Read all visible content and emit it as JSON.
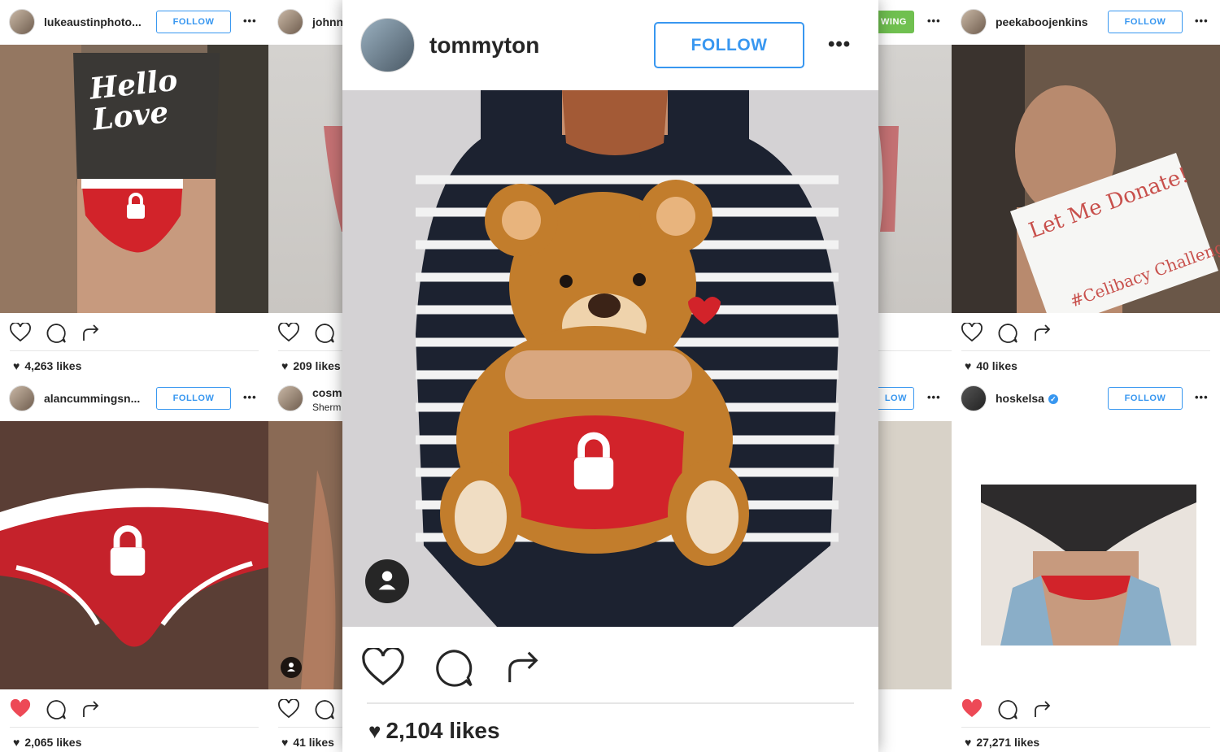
{
  "colors": {
    "accent": "#3897f0",
    "following": "#70c050",
    "like_red": "#ed4956",
    "brief_red": "#d2232a"
  },
  "posts": [
    {
      "id": "p1",
      "username": "lukeaustinphoto...",
      "follow_label": "FOLLOW",
      "more": "•••",
      "likes": "4,263 likes",
      "liked": false,
      "photo_text": "Hello Love"
    },
    {
      "id": "p2",
      "username": "johnn",
      "likes": "209 likes",
      "liked": false
    },
    {
      "id": "p3",
      "follow_label": "WING",
      "more": "•••"
    },
    {
      "id": "p4",
      "username": "peekaboojenkins",
      "follow_label": "FOLLOW",
      "more": "•••",
      "likes": "40 likes",
      "liked": false,
      "photo_text_1": "Let Me Donate!",
      "photo_text_2": "#Celibacy Challenge"
    },
    {
      "id": "p5",
      "username": "alancummingsn...",
      "follow_label": "FOLLOW",
      "more": "•••",
      "likes": "2,065 likes",
      "liked": true
    },
    {
      "id": "p6",
      "username": "cosm",
      "subline": "Sherm",
      "likes": "41 likes",
      "liked": false
    },
    {
      "id": "p7",
      "follow_label": "LOW",
      "more": "•••"
    },
    {
      "id": "p8",
      "username": "hoskelsa",
      "verified": true,
      "follow_label": "FOLLOW",
      "more": "•••",
      "likes": "27,271 likes",
      "liked": true
    },
    {
      "id": "main",
      "username": "tommyton",
      "follow_label": "FOLLOW",
      "more": "•••",
      "likes": "2,104 likes",
      "liked": false
    }
  ],
  "icons": [
    "heart-icon",
    "comment-icon",
    "share-icon",
    "more-icon",
    "user-tag-icon",
    "lock-icon",
    "verified-badge-icon"
  ]
}
